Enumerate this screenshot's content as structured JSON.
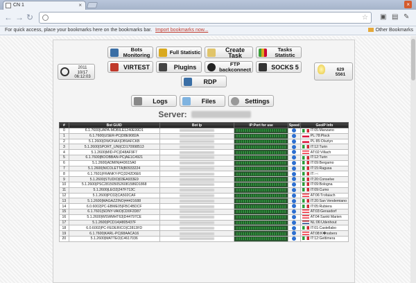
{
  "browser": {
    "tab_title": "CN 1",
    "url": "",
    "bookmarks_message": "For quick access, place your bookmarks here on the bookmarks bar.",
    "import_link": "Import bookmarks now...",
    "other_bookmarks": "Other Bookmarks"
  },
  "panel": {
    "clock": {
      "year": "2011",
      "date": "10/17",
      "time": "06:12:03"
    },
    "counter": {
      "top": "629",
      "bottom": "5561"
    },
    "buttons": {
      "bots_monitoring": "Bots Monitoring",
      "full_statistic": "Full Statistic",
      "create_task": "Create Task",
      "tasks_statistic": "Tasks Statistic",
      "virtest": "VIRTEST",
      "plugins": "Plugins",
      "ftp_backconnect": "FTP backconnect",
      "socks5": "SOCKS 5",
      "rdp": "RDP",
      "logs": "Logs",
      "files": "Files",
      "settings": "Settings"
    },
    "server_label": "Server:"
  },
  "table": {
    "headers": [
      "#",
      "Bot GUID",
      "Bot Ip",
      "IP:Port for use",
      "Speed",
      "GeoIP Info"
    ],
    "rows": [
      {
        "n": "0",
        "guid": "6.1.7600|UAPA-MOBILE1240E99D1",
        "geo": "IT:05:Manzano",
        "flag": "it"
      },
      {
        "n": "1",
        "guid": "6.1.7600|USER-PC|D8E9082A",
        "geo": "PL:78:Plock",
        "flag": "pl"
      },
      {
        "n": "2",
        "guid": "5.1.2600|DWONAX|DB9AFCKB",
        "geo": "PL:85:Olsztyn",
        "flag": "pl"
      },
      {
        "n": "3",
        "guid": "5.1.2600|SPORT_UNI|CD170998513",
        "geo": "IT:12:Turin",
        "flag": "it"
      },
      {
        "n": "4",
        "guid": "5.1.2600|MID-PC|D48AF9F7",
        "geo": "AT:02:Villach",
        "flag": "at"
      },
      {
        "n": "5",
        "guid": "6.1.7600|BOOBBAN-PC|AE1C4921",
        "geo": "IT:12:Turin",
        "flag": "it"
      },
      {
        "n": "6",
        "guid": "5.1.2600|ADMIN|443615A0",
        "geo": "IT:09:Bergamo",
        "flag": "it"
      },
      {
        "n": "7",
        "guid": "5.1.2600|NICOLETTA|B0933224",
        "geo": "IT:15:Ragusa",
        "flag": "it"
      },
      {
        "n": "8",
        "guid": "6.1.7601|FRANKY-PC|3242D6E6",
        "geo": "IT::--:",
        "flag": "it"
      },
      {
        "n": "9",
        "guid": "5.1.2600|STUDIO|03EA933E9",
        "geo": "IT:20:Conselve",
        "flag": "it"
      },
      {
        "n": "10",
        "guid": "5.1.2600|PSC2815050526081586D1868",
        "geo": "IT:09:Bologna",
        "flag": "it"
      },
      {
        "n": "11",
        "guid": "5.1.2600|LEO2|247F713C",
        "geo": "IT:09:Cumo",
        "flag": "it"
      },
      {
        "n": "12",
        "guid": "5.1.2600|PC02|CA502CAF",
        "geo": "AT:06:Trofaiach",
        "flag": "at"
      },
      {
        "n": "13",
        "guid": "5.1.2600|MAGAZZINO|44421688",
        "geo": "IT:20:San Vendemiano",
        "flag": "it"
      },
      {
        "n": "14",
        "guid": "6.0.6002|PC-EBME05|FBC4BDCF",
        "geo": "IT:05:Rubiera",
        "flag": "it"
      },
      {
        "n": "15",
        "guid": "6.1.7601|SONY-VAIO|CD0F2D87",
        "geo": "AT:03:Gerasdorf",
        "flag": "at"
      },
      {
        "n": "16",
        "guid": "5.1.2600|WSWMHT63|D44797CE",
        "geo": "AT:04:Sankt Marien",
        "flag": "at"
      },
      {
        "n": "17",
        "guid": "5.1.2600|PCD14|4805437F",
        "geo": "NL:06:Udenhout",
        "flag": "nl"
      },
      {
        "n": "18",
        "guid": "6.0.6002|PC-FEDERICO|C2813FD",
        "geo": "IT:01:Castellabo",
        "flag": "it"
      },
      {
        "n": "19",
        "guid": "6.1.7600|KARL-PC|68AACA16",
        "geo": "AT:08:K�ssbers",
        "flag": "at"
      },
      {
        "n": "20",
        "guid": "5.1.2600|MATTEO|C4617036",
        "geo": "IT:12:Gettimera",
        "flag": "it"
      }
    ]
  },
  "colors": {
    "it": "#2a9d3a",
    "pl": "#dc143c",
    "at": "#ed2939",
    "nl": "#21468b"
  }
}
